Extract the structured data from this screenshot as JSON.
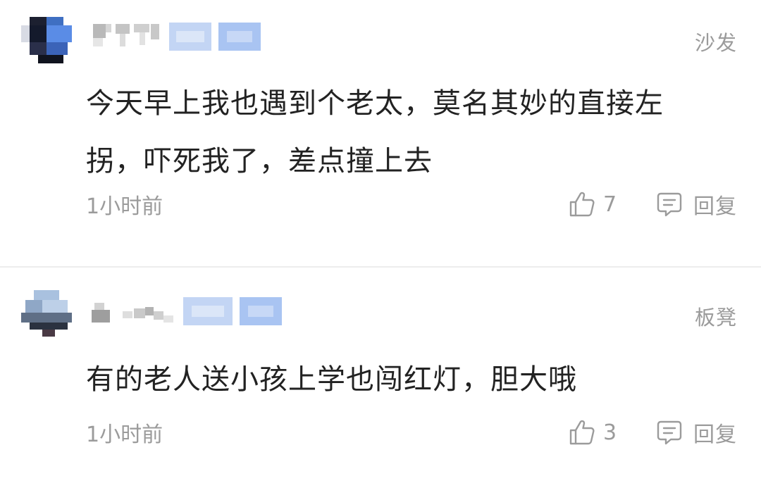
{
  "comments": [
    {
      "floor": "沙发",
      "text": "今天早上我也遇到个老太，莫名其妙的直接左拐，吓死我了，差点撞上去",
      "time": "1小时前",
      "likes": "7",
      "reply_label": "回复"
    },
    {
      "floor": "板凳",
      "text": "有的老人送小孩上学也闯红灯，胆大哦",
      "time": "1小时前",
      "likes": "3",
      "reply_label": "回复"
    }
  ],
  "colors": {
    "text_primary": "#222222",
    "text_secondary": "#9b9b9b",
    "divider": "#ededed",
    "badge_blue": "#a9c4f2"
  },
  "icons": {
    "like": "thumbs-up-icon",
    "reply": "chat-bubble-icon"
  }
}
